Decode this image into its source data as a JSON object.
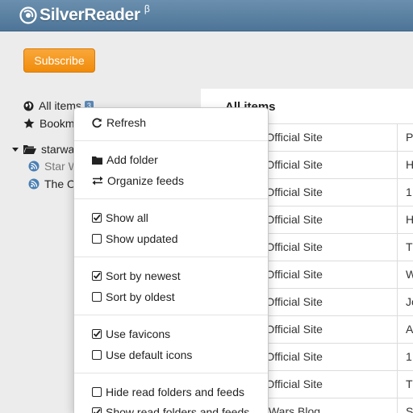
{
  "app": {
    "name": "SilverReader",
    "beta": "β"
  },
  "subscribe_label": "Subscribe",
  "sidebar": {
    "all_items": {
      "label": "All items",
      "count": "3"
    },
    "bookmarks": {
      "label": "Bookm"
    },
    "folder": {
      "label": "starwa"
    },
    "feeds": [
      {
        "label": "Star W"
      },
      {
        "label": "The O"
      }
    ]
  },
  "main": {
    "title": "All items",
    "rows": [
      {
        "source": "Wars - The Official Site",
        "title": "P"
      },
      {
        "source": "Wars - The Official Site",
        "title": "H"
      },
      {
        "source": "Wars - The Official Site",
        "title": "1"
      },
      {
        "source": "Wars - The Official Site",
        "title": "H"
      },
      {
        "source": "Wars - The Official Site",
        "title": "T"
      },
      {
        "source": "Wars - The Official Site",
        "title": "W"
      },
      {
        "source": "Wars - The Official Site",
        "title": "Jo"
      },
      {
        "source": "Wars - The Official Site",
        "title": "A"
      },
      {
        "source": "Wars - The Official Site",
        "title": "1"
      },
      {
        "source": "Wars - The Official Site",
        "title": "T"
      },
      {
        "source": "Official Star Wars Blog",
        "title": "S"
      }
    ]
  },
  "menu": {
    "refresh": "Refresh",
    "add_folder": "Add folder",
    "organize_feeds": "Organize feeds",
    "show_all": "Show all",
    "show_updated": "Show updated",
    "sort_newest": "Sort by newest",
    "sort_oldest": "Sort by oldest",
    "use_favicons": "Use favicons",
    "use_default_icons": "Use default icons",
    "hide_read": "Hide read folders and feeds",
    "show_read": "Show read folders and feeds"
  },
  "icons": {
    "logo": "silverreader-logo-icon",
    "all_items": "globe-icon",
    "bookmarks": "star-icon",
    "folder": "folder-open-icon",
    "feed": "feed-icon",
    "refresh": "refresh-icon",
    "add_folder": "folder-icon",
    "organize": "exchange-icon",
    "checked": "checkbox-checked-icon",
    "unchecked": "checkbox-empty-icon"
  },
  "colors": {
    "header": "#5a82a4",
    "accent": "#f39a1f",
    "count_badge": "#5b89b7",
    "feed_icon": "#4a7fb4"
  }
}
